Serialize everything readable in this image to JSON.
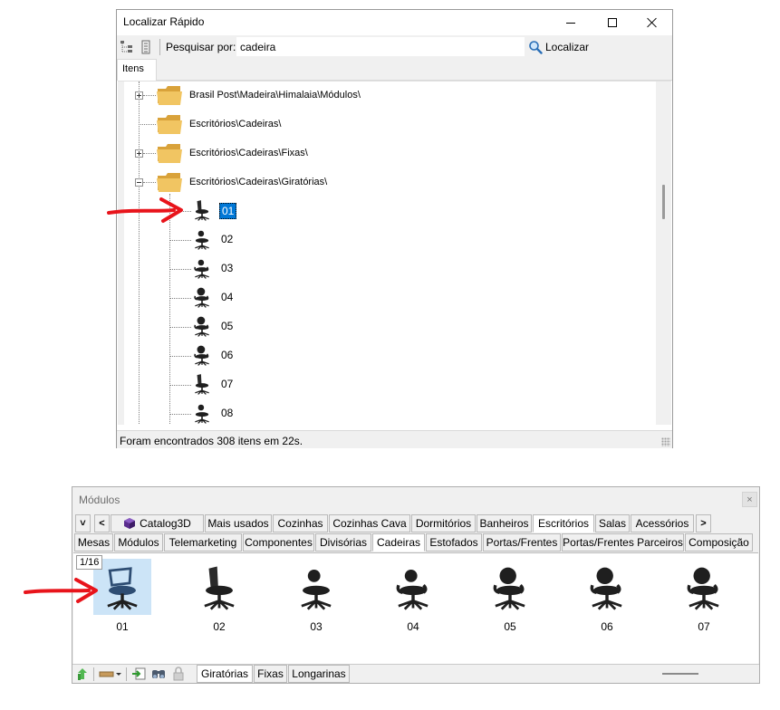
{
  "quick_find": {
    "title": "Localizar Rápido",
    "search_label": "Pesquisar por:",
    "search_value": "cadeira",
    "locate_label": "Localizar",
    "tab_label": "Itens",
    "folders": [
      {
        "label": "Brasil Post\\Madeira\\Himalaia\\Módulos\\",
        "expander": "plus"
      },
      {
        "label": "Escritórios\\Cadeiras\\",
        "expander": "none"
      },
      {
        "label": "Escritórios\\Cadeiras\\Fixas\\",
        "expander": "plus"
      },
      {
        "label": "Escritórios\\Cadeiras\\Giratórias\\",
        "expander": "minus"
      }
    ],
    "items": [
      "01",
      "02",
      "03",
      "04",
      "05",
      "06",
      "07",
      "08"
    ],
    "selected_item": "01",
    "status": "Foram encontrados 308 itens em 22s."
  },
  "modules": {
    "title": "Módulos",
    "close_label": "×",
    "nav_down": "˅",
    "nav_left": "<",
    "nav_right": ">",
    "tabs_row1": [
      "Catalog3D",
      "Mais usados",
      "Cozinhas",
      "Cozinhas Cava",
      "Dormitórios",
      "Banheiros",
      "Escritórios",
      "Salas",
      "Acessórios"
    ],
    "active_tab_row1": "Escritórios",
    "tabs_row2": [
      "Mesas",
      "Módulos",
      "Telemarketing",
      "Componentes",
      "Divisórias",
      "Cadeiras",
      "Estofados",
      "Portas/Frentes",
      "Portas/Frentes Parceiros",
      "Composição"
    ],
    "active_tab_row2": "Cadeiras",
    "page_indicator": "1/16",
    "thumbnails": [
      "01",
      "02",
      "03",
      "04",
      "05",
      "06",
      "07"
    ],
    "selected_thumbnail": "01",
    "bottom_tabs": [
      "Giratórias",
      "Fixas",
      "Longarinas"
    ],
    "active_bottom_tab": "Giratórias"
  },
  "colors": {
    "selection": "#0078d7",
    "thumb_selection": "#cce4f7",
    "arrow": "#e8141b",
    "folder": "#e9b44c"
  }
}
